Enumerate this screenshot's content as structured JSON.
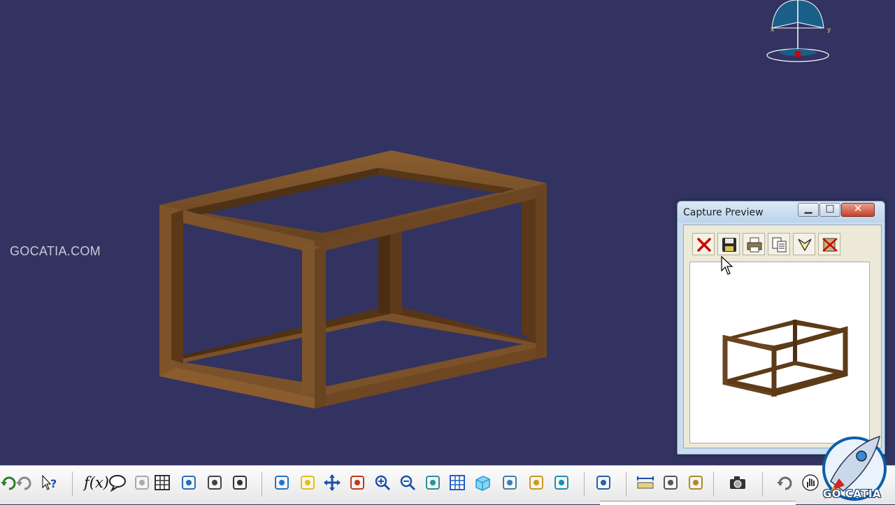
{
  "watermark": "GOCATIA.COM",
  "capture_window": {
    "title": "Capture Preview",
    "minimize_glyph": "▁",
    "maximize_glyph": "□",
    "close_glyph": "✕",
    "toolbar": [
      {
        "name": "delete-icon",
        "color": "#d00000"
      },
      {
        "name": "save-icon"
      },
      {
        "name": "print-icon"
      },
      {
        "name": "copy-icon"
      },
      {
        "name": "select-mode-icon"
      },
      {
        "name": "no-album-icon"
      }
    ]
  },
  "toolbar": {
    "fx_label": "f(x)",
    "icons": [
      "undo-icon",
      "redo-icon",
      "whats-this-icon",
      "formula-icon",
      "comment-icon",
      "disabled-icon",
      "table-icon",
      "tree-icon",
      "lock-icon",
      "macro-icon",
      "fly-mode-icon",
      "fit-all-icon",
      "pan-icon",
      "rotate-icon",
      "zoom-in-icon",
      "zoom-out-icon",
      "normal-view-icon",
      "multi-view-icon",
      "iso-view-icon",
      "render-style-icon",
      "hide-show-icon",
      "swap-space-icon",
      "update-icon",
      "measure-between-icon",
      "measure-item-icon",
      "measure-inertia-icon",
      "capture-icon",
      "refresh-icon",
      "cursor-hand-icon"
    ]
  },
  "logo": {
    "text": "GO CATIA"
  },
  "colors": {
    "background": "#333361",
    "wood": "#6b4520",
    "accent": "#0a5ea8"
  }
}
